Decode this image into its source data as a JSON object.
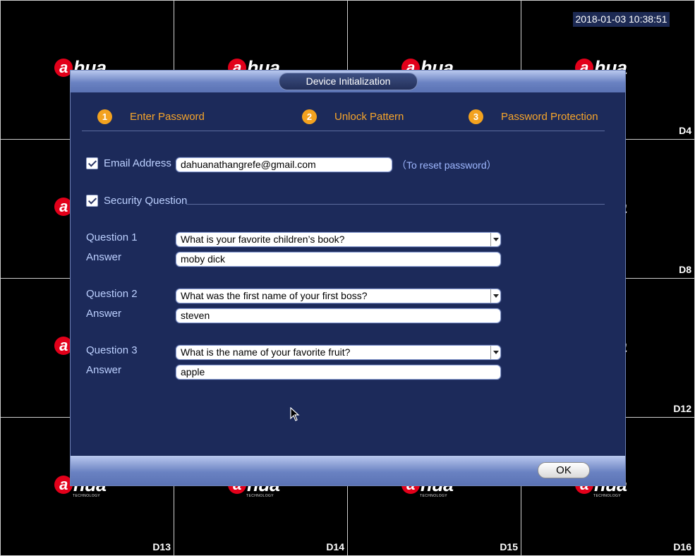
{
  "camera_grid": {
    "logo_text": "alhua",
    "logo_subtext": "TECHNOLOGY",
    "channels": [
      "",
      "",
      "",
      "D4",
      "",
      "",
      "",
      "D8",
      "",
      "",
      "",
      "D12",
      "D13",
      "D14",
      "D15",
      "D16"
    ]
  },
  "clock": "2018-01-03 10:38:51",
  "dialog": {
    "title": "Device Initialization",
    "steps": [
      {
        "num": "1",
        "label": "Enter Password"
      },
      {
        "num": "2",
        "label": "Unlock Pattern"
      },
      {
        "num": "3",
        "label": "Password Protection"
      }
    ],
    "email": {
      "checked": true,
      "label": "Email Address",
      "value": "dahuanathangrefe@gmail.com",
      "hint": "（To reset password）"
    },
    "security_question": {
      "checked": true,
      "label": "Security Question"
    },
    "questions": [
      {
        "label": "Question 1",
        "selected": "What is your favorite children’s book?",
        "answer_label": "Answer",
        "answer": "moby dick"
      },
      {
        "label": "Question 2",
        "selected": "What was the first name of your first boss?",
        "answer_label": "Answer",
        "answer": "steven"
      },
      {
        "label": "Question 3",
        "selected": "What is the name of your favorite fruit?",
        "answer_label": "Answer",
        "answer": "apple"
      }
    ],
    "ok_label": "OK"
  },
  "colors": {
    "dialog_bg": "#1c2a5a",
    "step_accent": "#f3a21f",
    "label_text": "#bcd0ff"
  }
}
